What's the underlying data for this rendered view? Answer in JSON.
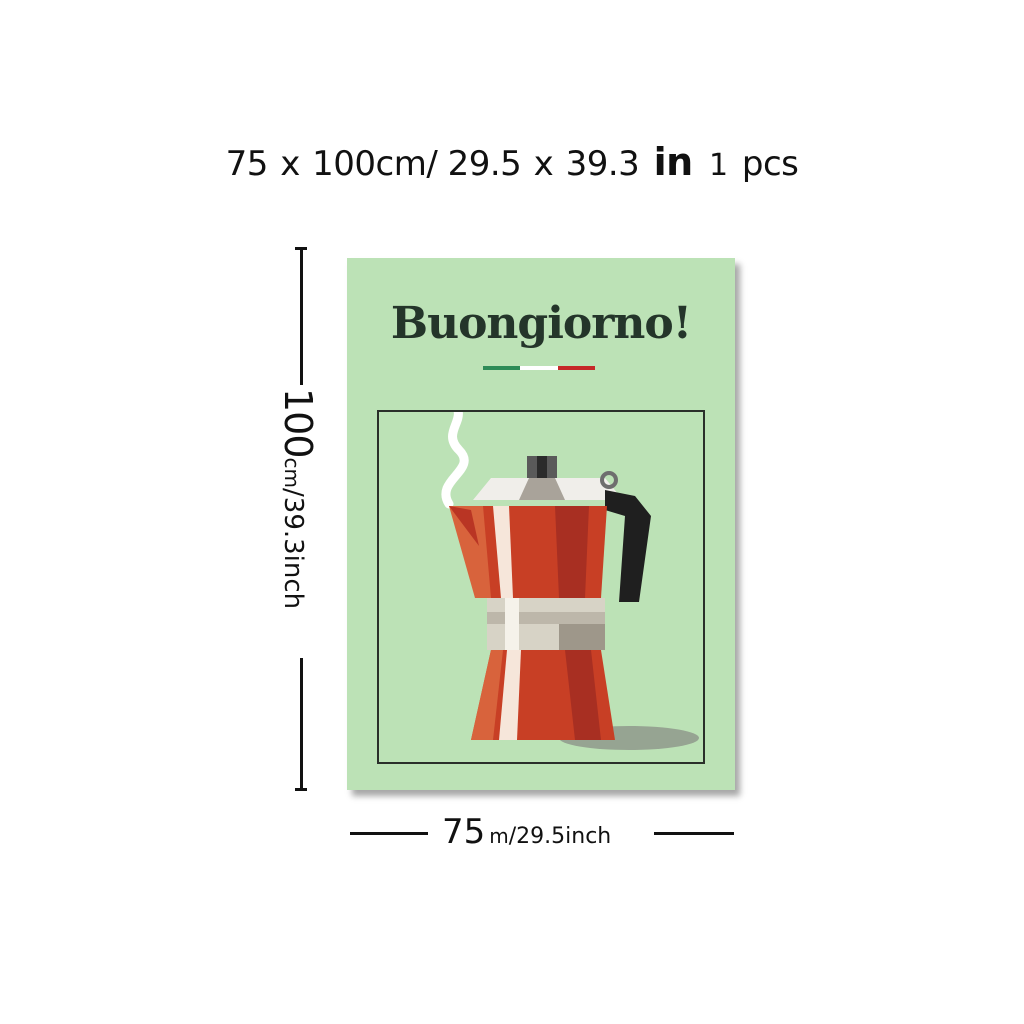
{
  "headline": {
    "width_num": "75",
    "x1": "x",
    "height_num": "100cm/",
    "width_in": "29.5",
    "x2": "x",
    "height_in": "39.3",
    "in_label": "in",
    "pcs_num": "1",
    "pcs_word": "pcs"
  },
  "vertical_label": {
    "num": "100",
    "unit": "cm",
    "inch": "/39.3inch"
  },
  "horizontal_label": {
    "num": "75",
    "unit": "m",
    "inch": "/29.5inch"
  },
  "poster": {
    "title": "Buongiorno!",
    "background": "#bce2b6",
    "flag_colors": [
      "#2e8b57",
      "#ffffff",
      "#c62828"
    ],
    "illustration": "moka-pot"
  }
}
